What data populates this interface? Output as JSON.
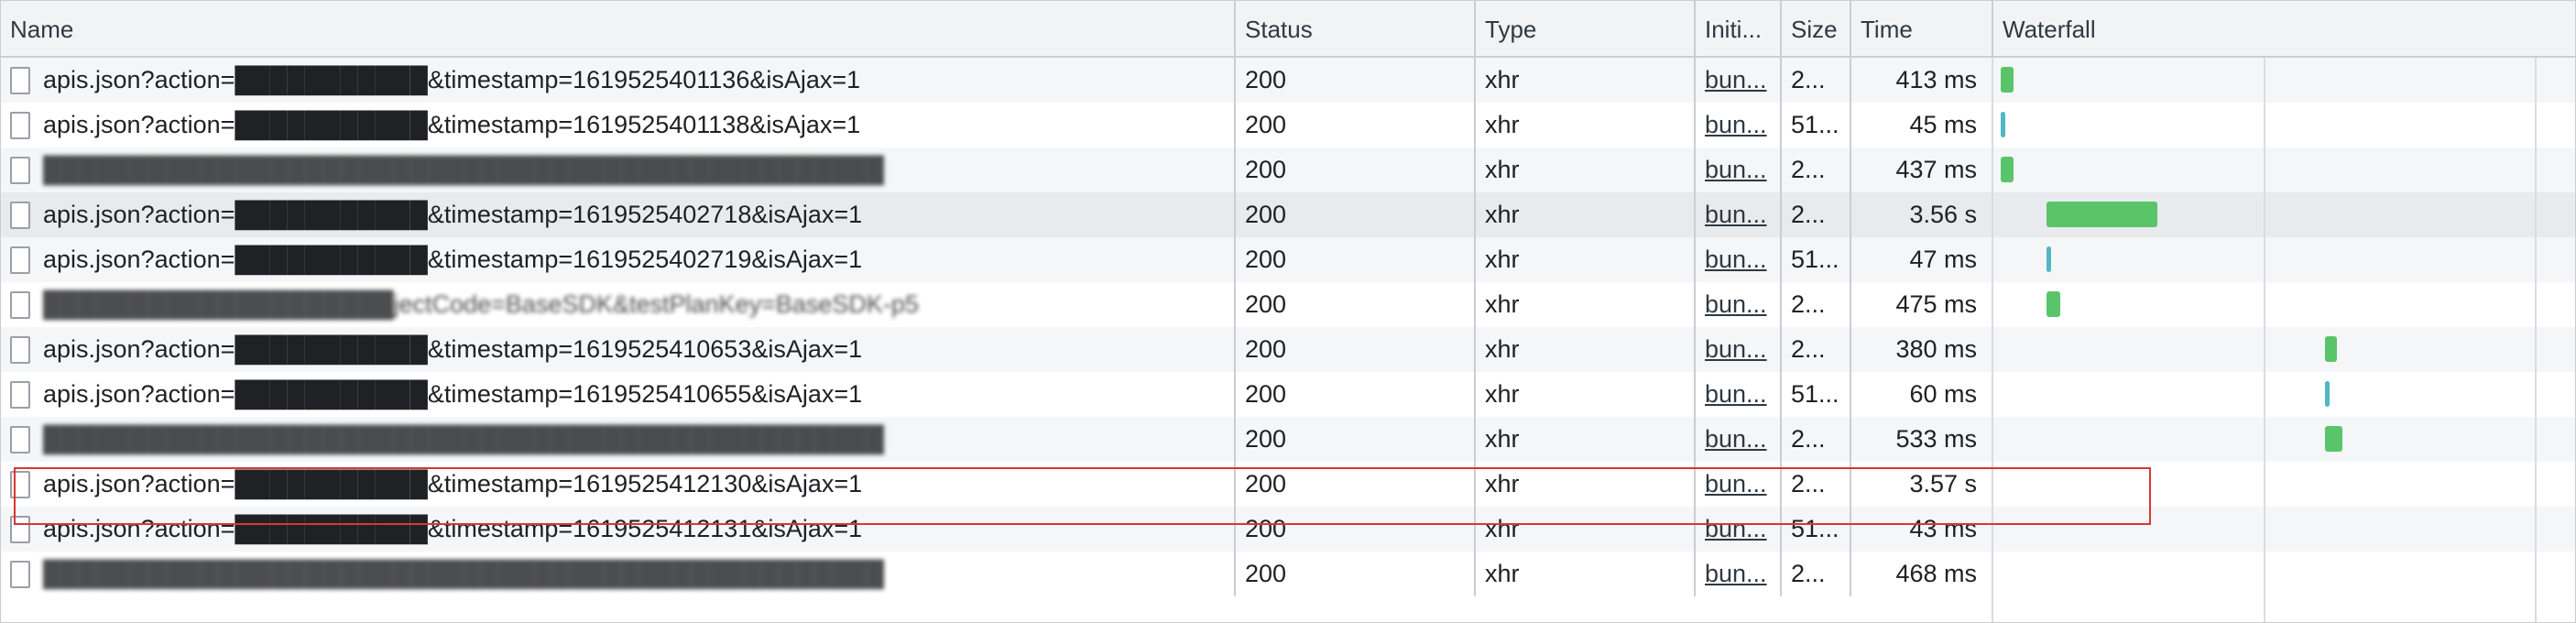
{
  "columns": {
    "name": "Name",
    "status": "Status",
    "type": "Type",
    "initiator": "Initi...",
    "size": "Size",
    "time": "Time",
    "waterfall": "Waterfall"
  },
  "requests": [
    {
      "name": "apis.json?action=███████████&timestamp=1619525401136&isAjax=1",
      "status": "200",
      "type": "xhr",
      "initiator": "bun...",
      "size": "2...",
      "time": "413 ms",
      "wf_start": 0.012,
      "wf_len": 0.022,
      "wf_kind": "normal"
    },
    {
      "name": "apis.json?action=███████████&timestamp=1619525401138&isAjax=1",
      "status": "200",
      "type": "xhr",
      "initiator": "bun...",
      "size": "51...",
      "time": "45 ms",
      "wf_start": 0.012,
      "wf_len": 0.004,
      "wf_kind": "thin"
    },
    {
      "name": "████████████████████████████████████████████████",
      "status": "200",
      "type": "xhr",
      "initiator": "bun...",
      "size": "2...",
      "time": "437 ms",
      "wf_start": 0.012,
      "wf_len": 0.022,
      "wf_kind": "normal"
    },
    {
      "name": "apis.json?action=███████████&timestamp=1619525402718&isAjax=1",
      "status": "200",
      "type": "xhr",
      "initiator": "bun...",
      "size": "2...",
      "time": "3.56 s",
      "wf_start": 0.091,
      "wf_len": 0.19,
      "wf_kind": "normal"
    },
    {
      "name": "apis.json?action=███████████&timestamp=1619525402719&isAjax=1",
      "status": "200",
      "type": "xhr",
      "initiator": "bun...",
      "size": "51...",
      "time": "47 ms",
      "wf_start": 0.091,
      "wf_len": 0.005,
      "wf_kind": "thin"
    },
    {
      "name": "████████████████████jectCode=BaseSDK&testPlanKey=BaseSDK-p5",
      "status": "200",
      "type": "xhr",
      "initiator": "bun...",
      "size": "2...",
      "time": "475 ms",
      "wf_start": 0.091,
      "wf_len": 0.024,
      "wf_kind": "normal"
    },
    {
      "name": "apis.json?action=███████████&timestamp=1619525410653&isAjax=1",
      "status": "200",
      "type": "xhr",
      "initiator": "bun...",
      "size": "2...",
      "time": "380 ms",
      "wf_start": 0.569,
      "wf_len": 0.02,
      "wf_kind": "normal"
    },
    {
      "name": "apis.json?action=███████████&timestamp=1619525410655&isAjax=1",
      "status": "200",
      "type": "xhr",
      "initiator": "bun...",
      "size": "51...",
      "time": "60 ms",
      "wf_start": 0.569,
      "wf_len": 0.006,
      "wf_kind": "thin"
    },
    {
      "name": "████████████████████████████████████████████████",
      "status": "200",
      "type": "xhr",
      "initiator": "bun...",
      "size": "2...",
      "time": "533 ms",
      "wf_start": 0.569,
      "wf_len": 0.03,
      "wf_kind": "normal"
    },
    {
      "name": "apis.json?action=███████████&timestamp=1619525412130&isAjax=1",
      "status": "200",
      "type": "xhr",
      "initiator": "bun...",
      "size": "2...",
      "time": "3.57 s",
      "wf_start": 0,
      "wf_len": 0,
      "wf_kind": "none"
    },
    {
      "name": "apis.json?action=███████████&timestamp=1619525412131&isAjax=1",
      "status": "200",
      "type": "xhr",
      "initiator": "bun...",
      "size": "51...",
      "time": "43 ms",
      "wf_start": 0,
      "wf_len": 0,
      "wf_kind": "none"
    },
    {
      "name": "████████████████████████████████████████████████",
      "status": "200",
      "type": "xhr",
      "initiator": "bun...",
      "size": "2...",
      "time": "468 ms",
      "wf_start": 0,
      "wf_len": 0,
      "wf_kind": "none"
    }
  ],
  "colors": {
    "bar_green": "#5ac46a",
    "bar_teal": "#4fb8c4",
    "highlight": "#d93636",
    "selected_row": "#e8eaed"
  }
}
